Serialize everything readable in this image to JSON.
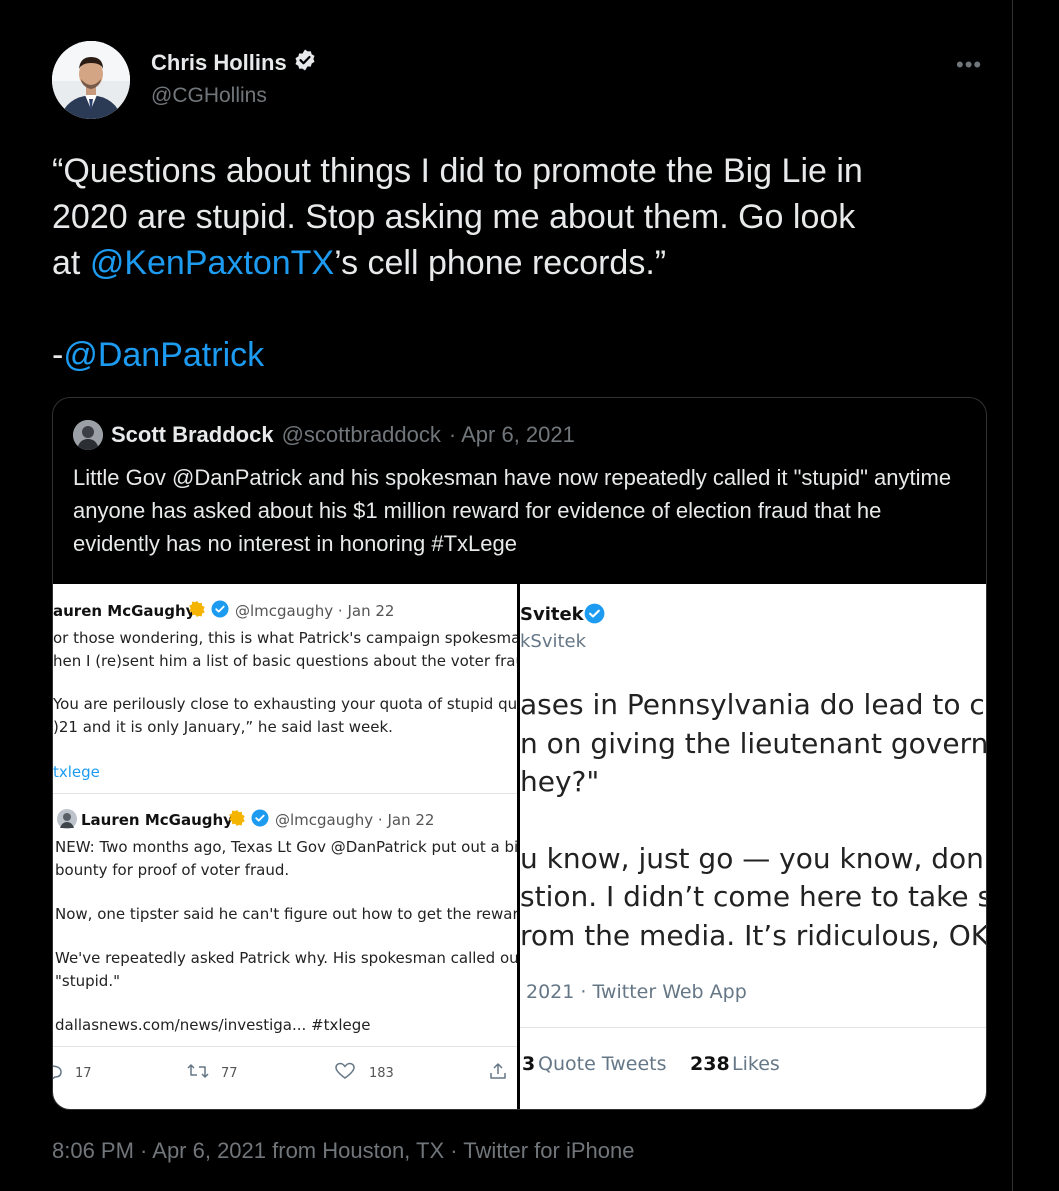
{
  "author": {
    "name": "Chris Hollins",
    "handle": "@CGHollins"
  },
  "more_label": "•••",
  "tweet": {
    "line1": "“Questions about things I did to promote the Big Lie in",
    "line2": "2020 are stupid.  Stop asking me about them.  Go look",
    "line3_pre": "at ",
    "line3_mention": "@KenPaxtonTX",
    "line3_post": "’s cell phone records.”",
    "sig_pre": "-",
    "sig_mention": "@DanPatrick"
  },
  "quote": {
    "name": "Scott Braddock",
    "handle": "@scottbraddock",
    "date": "· Apr 6, 2021",
    "text": "Little Gov @DanPatrick and his spokesman have now repeatedly called it \"stupid\" anytime anyone has asked about his $1 million reward for evidence of election fraud that he evidently has no interest in honoring #TxLege",
    "left_image": {
      "t1_name": "auren McGaughy",
      "t1_meta": "@lmcgaughy · Jan 22",
      "t1_l1": "or those wondering, this is what Patrick's campaign spokesman t",
      "t1_l2": "hen I (re)sent him a list of basic questions about the voter fraud",
      "t1_l3": "You are perilously close to exhausting your quota of stupid quest",
      "t1_l4": ")21 and it is only January,” he said last week.",
      "t1_tag": "txlege",
      "t2_name": "Lauren McGaughy",
      "t2_meta": "@lmcgaughy · Jan 22",
      "t2_l1": "NEW: Two months ago, Texas Lt Gov @DanPatrick put out a big",
      "t2_l2": "bounty for proof of voter fraud.",
      "t2_l3": "Now, one tipster said he can't figure out how to get the reward.",
      "t2_l4": "We've repeatedly asked Patrick why. His spokesman called our q",
      "t2_l5": "\"stupid.\"",
      "t2_l6": "dallasnews.com/news/investiga... #txlege",
      "replies": "17",
      "retweets": "77",
      "likes": "183"
    },
    "right_image": {
      "name": "Svitek",
      "handle": "kSvitek",
      "l1": "ases in Pennsylvania do lead to co",
      "l2": "n on giving the lieutenant governo",
      "l3": "hey?\"",
      "l4": "u know, just go — you know, don",
      "l5": "stion. I didn’t come here to take st",
      "l6": "rom the media. It’s ridiculous, OK?",
      "meta": "2021 · Twitter Web App",
      "quote_count": "3",
      "quote_label": "Quote Tweets",
      "likes_count": "238",
      "likes_label": "Likes"
    }
  },
  "timestamp": "8:06 PM · Apr 6, 2021 from Houston, TX · Twitter for iPhone",
  "colors": {
    "background": "#000000",
    "text": "#e7e9ea",
    "secondary": "#71767b",
    "link": "#1d9bf0",
    "verified": "#1d9bf0",
    "gold_badge": "#f4b400"
  },
  "icons": [
    "verified-badge-icon",
    "more-options-icon",
    "reply-icon",
    "retweet-icon",
    "like-icon",
    "share-icon"
  ]
}
